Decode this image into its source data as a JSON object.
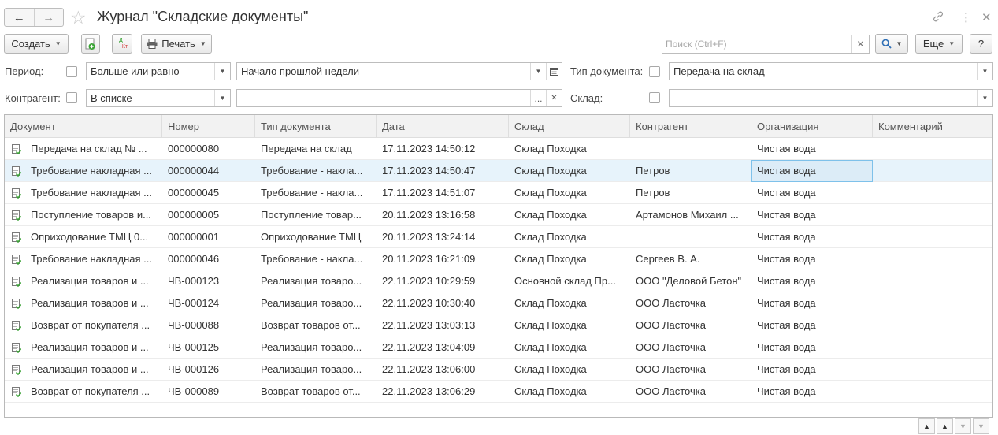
{
  "window": {
    "title": "Журнал \"Складские документы\"",
    "back_icon": "arrow-left-icon",
    "forward_icon": "arrow-right-icon",
    "favorite_icon": "star-icon",
    "link_icon": "link-icon",
    "more_icon": "vertical-dots-icon",
    "close_icon": "close-icon"
  },
  "toolbar": {
    "create_label": "Создать",
    "print_label": "Печать",
    "more_label": "Еще",
    "help_label": "?",
    "search_placeholder": "Поиск (Ctrl+F)",
    "dtkt_top": "Дт",
    "dtkt_bottom": "Кт"
  },
  "filters": {
    "period_label": "Период:",
    "period_condition": "Больше или равно",
    "period_value": "Начало прошлой недели",
    "doc_type_label": "Тип документа:",
    "doc_type_value": "Передача на склад",
    "counterparty_label": "Контрагент:",
    "counterparty_condition": "В списке",
    "counterparty_value": "",
    "warehouse_label": "Склад:",
    "warehouse_value": "",
    "ellipsis_label": "..."
  },
  "table": {
    "columns": [
      "Документ",
      "Номер",
      "Тип документа",
      "Дата",
      "Склад",
      "Контрагент",
      "Организация",
      "Комментарий"
    ],
    "rows": [
      [
        "Передача на склад № ...",
        "000000080",
        "Передача на склад",
        "17.11.2023 14:50:12",
        "Склад Походка",
        "",
        "Чистая вода",
        ""
      ],
      [
        "Требование накладная ...",
        "000000044",
        "Требование - накла...",
        "17.11.2023 14:50:47",
        "Склад Походка",
        "Петров",
        "Чистая вода",
        ""
      ],
      [
        "Требование накладная ...",
        "000000045",
        "Требование - накла...",
        "17.11.2023 14:51:07",
        "Склад Походка",
        "Петров",
        "Чистая вода",
        ""
      ],
      [
        "Поступление товаров и...",
        "000000005",
        "Поступление товар...",
        "20.11.2023 13:16:58",
        "Склад Походка",
        "Артамонов Михаил ...",
        "Чистая вода",
        ""
      ],
      [
        "Оприходование ТМЦ 0...",
        "000000001",
        "Оприходование ТМЦ",
        "20.11.2023 13:24:14",
        "Склад Походка",
        "",
        "Чистая вода",
        ""
      ],
      [
        "Требование накладная ...",
        "000000046",
        "Требование - накла...",
        "20.11.2023 16:21:09",
        "Склад Походка",
        "Сергеев В. А.",
        "Чистая вода",
        ""
      ],
      [
        "Реализация товаров и ...",
        "ЧВ-000123",
        "Реализация товаро...",
        "22.11.2023 10:29:59",
        "Основной склад Пр...",
        "ООО \"Деловой Бетон\"",
        "Чистая вода",
        ""
      ],
      [
        "Реализация товаров и ...",
        "ЧВ-000124",
        "Реализация товаро...",
        "22.11.2023 10:30:40",
        "Склад Походка",
        "ООО Ласточка",
        "Чистая вода",
        ""
      ],
      [
        "Возврат от покупателя ...",
        "ЧВ-000088",
        "Возврат товаров от...",
        "22.11.2023 13:03:13",
        "Склад Походка",
        "ООО Ласточка",
        "Чистая вода",
        ""
      ],
      [
        "Реализация товаров и ...",
        "ЧВ-000125",
        "Реализация товаро...",
        "22.11.2023 13:04:09",
        "Склад Походка",
        "ООО Ласточка",
        "Чистая вода",
        ""
      ],
      [
        "Реализация товаров и ...",
        "ЧВ-000126",
        "Реализация товаро...",
        "22.11.2023 13:06:00",
        "Склад Походка",
        "ООО Ласточка",
        "Чистая вода",
        ""
      ],
      [
        "Возврат от покупателя ...",
        "ЧВ-000089",
        "Возврат товаров от...",
        "22.11.2023 13:06:29",
        "Склад Походка",
        "ООО Ласточка",
        "Чистая вода",
        ""
      ]
    ]
  },
  "colors": {
    "accent": "#3d8ad8",
    "selected_row": "#e7f3fb",
    "doc_icon_green": "#3aa335"
  }
}
